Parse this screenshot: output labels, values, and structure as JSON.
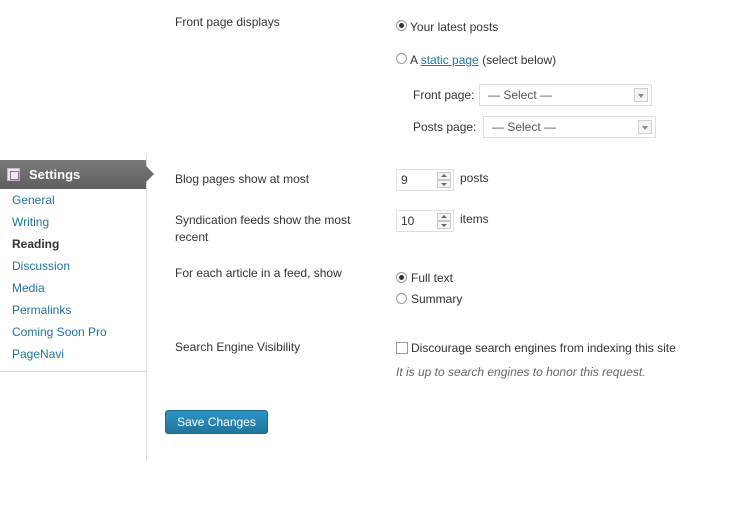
{
  "sidebar": {
    "title": "Settings",
    "items": [
      {
        "label": "General",
        "current": false
      },
      {
        "label": "Writing",
        "current": false
      },
      {
        "label": "Reading",
        "current": true
      },
      {
        "label": "Discussion",
        "current": false
      },
      {
        "label": "Media",
        "current": false
      },
      {
        "label": "Permalinks",
        "current": false
      },
      {
        "label": "Coming Soon Pro",
        "current": false
      },
      {
        "label": "PageNavi",
        "current": false
      }
    ]
  },
  "front_page": {
    "label": "Front page displays",
    "option_latest": "Your latest posts",
    "option_static_prefix": "A",
    "option_static_link": "static page",
    "option_static_suffix": "(select below)",
    "selected": "latest",
    "front_page_label": "Front page:",
    "front_page_value": "— Select —",
    "posts_page_label": "Posts page:",
    "posts_page_value": "— Select —"
  },
  "blog_pages": {
    "label": "Blog pages show at most",
    "value": "9",
    "unit": "posts"
  },
  "syndication": {
    "label": "Syndication feeds show the most recent",
    "value": "10",
    "unit": "items"
  },
  "feed_article": {
    "label": "For each article in a feed, show",
    "option_full": "Full text",
    "option_summary": "Summary",
    "selected": "full"
  },
  "search_visibility": {
    "label": "Search Engine Visibility",
    "checkbox_label": "Discourage search engines from indexing this site",
    "checked": false,
    "description": "It is up to search engines to honor this request."
  },
  "save_button": "Save Changes",
  "colors": {
    "link": "#21759b",
    "button": "#21759b",
    "sidebar_header": "#6b6b6b"
  }
}
